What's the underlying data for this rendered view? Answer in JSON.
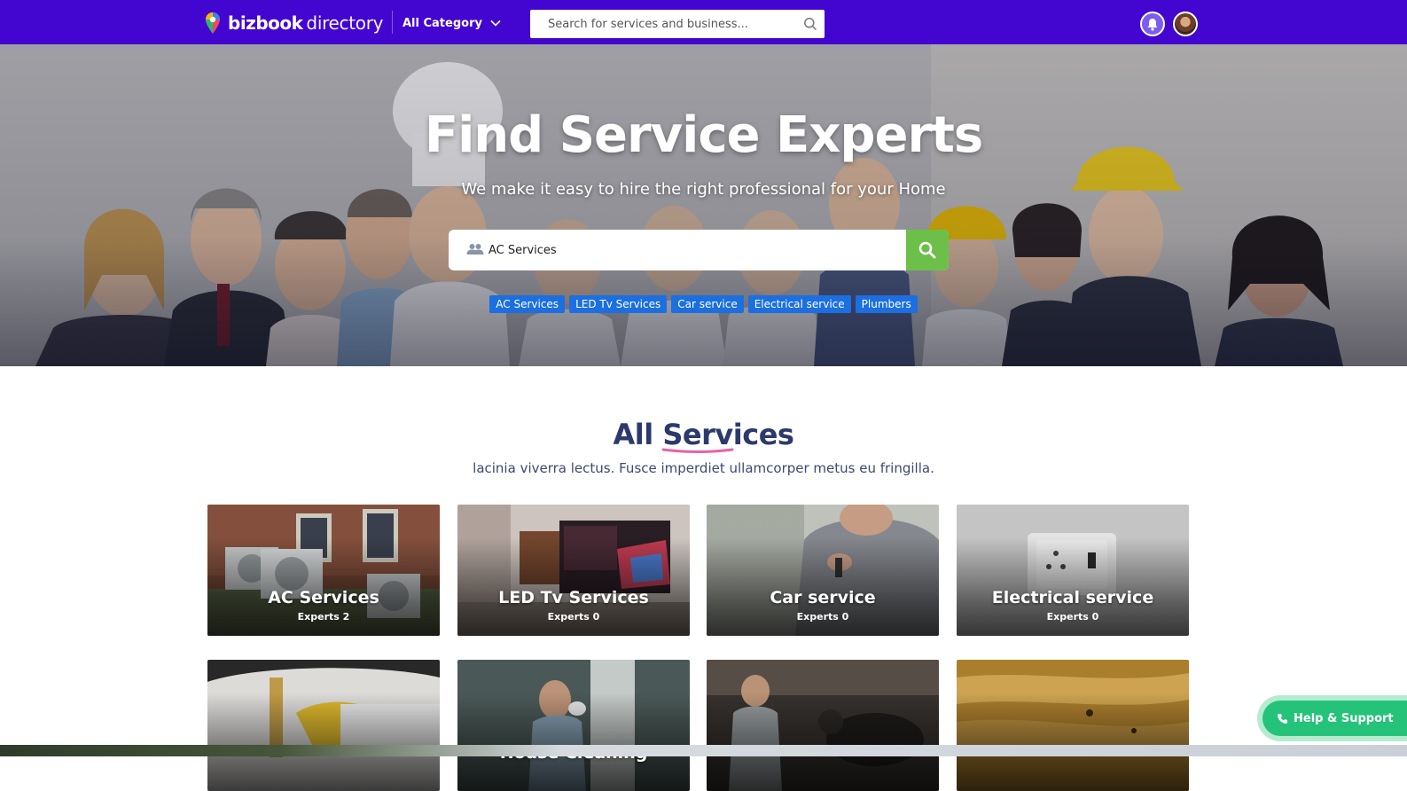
{
  "header": {
    "logo_primary": "bizbook",
    "logo_secondary": "directory",
    "category_label": "All Category",
    "search_placeholder": "Search for services and business...",
    "notification_icon": "bell-icon",
    "avatar_icon": "user-avatar"
  },
  "hero": {
    "title": "Find Service Experts",
    "subtitle": "We make it easy to hire the right professional for your Home",
    "search_value": "AC Services",
    "search_icon": "search-icon",
    "tags": [
      "AC Services",
      "LED Tv Services",
      "Car service",
      "Electrical service",
      "Plumbers"
    ]
  },
  "services": {
    "title_a": "All",
    "title_b": "Services",
    "subtitle": "lacinia viverra lectus. Fusce imperdiet ullamcorper metus eu fringilla.",
    "cards": [
      {
        "name": "AC Services",
        "experts": "Experts 2"
      },
      {
        "name": "LED Tv Services",
        "experts": "Experts 0"
      },
      {
        "name": "Car service",
        "experts": "Experts 0"
      },
      {
        "name": "Electrical service",
        "experts": "Experts 0"
      },
      {
        "name": "",
        "experts": ""
      },
      {
        "name": "House Cleaning",
        "experts": ""
      },
      {
        "name": "",
        "experts": ""
      },
      {
        "name": "",
        "experts": ""
      }
    ]
  },
  "help": {
    "label": "Help & Support",
    "icon": "phone-icon"
  },
  "colors": {
    "topbar": "#4306d0",
    "tag": "#1b6fe0",
    "search_button": "#6cc04a",
    "help_button": "#25c37a",
    "title_text": "#2c3a6b"
  }
}
